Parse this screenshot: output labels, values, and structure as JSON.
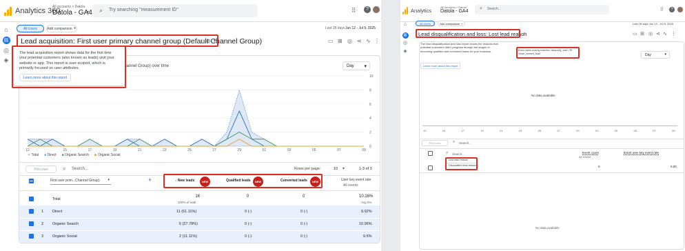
{
  "left": {
    "app_name": "Analytics 360",
    "account_path": "All accounts > Datola",
    "property": "Datola - GA4",
    "search_placeholder": "Try searching \"measurement ID\"",
    "segment": "All Users",
    "add_comparison": "Add comparison",
    "date_prefix": "Last 28 days",
    "date_range": "Jun 12 - Jul 9, 2025",
    "report_title": "Lead acquisition: First user primary channel group (Default Channel Group)",
    "tooltip_text": "The lead acquisition report shows data for the first time your potential customers (also known as leads) visit your website or app. This report is user-scoped, which is primarily focused on user attributes.",
    "tooltip_link": "Learn more about this report",
    "chart_caption_tail": "Channel Group) over time",
    "granularity": "Day",
    "table": {
      "search_placeholder": "Search...",
      "plot_rows": "Plot rows",
      "rows_per_page_label": "Rows per page:",
      "rows_per_page": "10",
      "pagination": "1-3 of 3",
      "dimension": "First user prim...Channel Group)",
      "columns": [
        "New leads",
        "Qualified leads",
        "Converted leads",
        "User key event rate"
      ],
      "col_sub": "All events",
      "badge": "NEW",
      "total_label": "Total",
      "totals": [
        "16",
        "0",
        "0",
        "10.16%"
      ],
      "totals_sub": [
        "100% of total",
        "",
        "",
        "Avg 0%"
      ],
      "rows": [
        {
          "n": "1",
          "name": "Direct",
          "v": [
            "11 (61.11%)",
            "0 (-)",
            "0 (-)",
            "9.92%"
          ]
        },
        {
          "n": "2",
          "name": "Organic Search",
          "v": [
            "5 (27.78%)",
            "0 (-)",
            "0 (-)",
            "10.96%"
          ]
        },
        {
          "n": "3",
          "name": "Organic Social",
          "v": [
            "2 (11.11%)",
            "0 (-)",
            "0 (-)",
            "9.5%"
          ]
        }
      ]
    }
  },
  "chart_data": {
    "type": "area",
    "x": [
      "12 Jun",
      "13",
      "14",
      "15",
      "16",
      "17",
      "18",
      "19",
      "20",
      "21",
      "22",
      "23",
      "24",
      "25",
      "26",
      "27",
      "28",
      "29",
      "30",
      "01 Jul",
      "02",
      "03",
      "04",
      "05",
      "06",
      "07",
      "08",
      "09"
    ],
    "x_ticks": [
      "12 Jun",
      "15",
      "17",
      "19",
      "21",
      "23",
      "25",
      "27",
      "29",
      "01 Jul",
      "03",
      "05",
      "07",
      "09"
    ],
    "y_ticks": [
      "10",
      "8",
      "6",
      "4",
      "2",
      "0"
    ],
    "ylim": [
      0,
      10
    ],
    "legend": [
      "Total",
      "Direct",
      "Organic Search",
      "Organic Social"
    ],
    "series": [
      {
        "name": "Total",
        "color": "#7aa6d6",
        "values": [
          1,
          1,
          1,
          0,
          0,
          1,
          0,
          0,
          1,
          1,
          0,
          1,
          0,
          0,
          1,
          0,
          2,
          8,
          2,
          1,
          0,
          0,
          0,
          0,
          0,
          0,
          0,
          0
        ]
      },
      {
        "name": "Direct",
        "color": "#3b78c4",
        "values": [
          1,
          0,
          1,
          0,
          0,
          0,
          0,
          0,
          1,
          0,
          0,
          1,
          0,
          0,
          1,
          0,
          1,
          5,
          1,
          0,
          0,
          0,
          0,
          0,
          0,
          0,
          0,
          0
        ]
      },
      {
        "name": "Organic Search",
        "color": "#4d9a6a",
        "values": [
          0,
          1,
          0,
          0,
          0,
          1,
          0,
          0,
          0,
          1,
          0,
          0,
          0,
          0,
          0,
          0,
          1,
          2,
          1,
          1,
          0,
          0,
          0,
          0,
          0,
          0,
          0,
          0
        ]
      },
      {
        "name": "Organic Social",
        "color": "#e8a33a",
        "values": [
          0,
          0,
          0,
          0,
          0,
          0,
          0,
          0,
          0,
          0,
          0,
          0,
          0,
          0,
          0,
          0,
          0,
          1,
          0,
          0,
          0,
          0,
          0,
          0,
          0,
          0,
          0,
          0
        ]
      }
    ]
  },
  "right": {
    "app_name": "Analytics",
    "account_path": "All accounts > Datola",
    "property": "Datola - GA4",
    "search_placeholder": "Search...",
    "segment": "All Users",
    "add_comparison": "Add comparison",
    "date_range": "Last 28 days  Jun 12 - Jul 9, 2025",
    "report_title": "Lead disqualification and loss: Lost lead reason",
    "tooltip_text": "The lead disqualification and loss report shows the reasons that potential customers didn't progress through the stages of becoming qualified and converted leads for your business.",
    "tooltip_link": "Learn more about this report",
    "note_text": "Event name exactly matches 'disqualify_lead' OR 'close_convert_lead'",
    "granularity": "Day",
    "no_data": "No data available",
    "x_ticks": [
      "12 Jun",
      "15",
      "17",
      "19",
      "21",
      "23",
      "25",
      "27",
      "29",
      "01 Jul",
      "03",
      "05",
      "07",
      "09"
    ],
    "plot_rows": "Plot rows",
    "col_event_count": "Event count",
    "col_event_sub": "All events",
    "col_key_rate": "Event user key event rate",
    "dim_labels": [
      "Lost lead reason",
      "Disqualified lead reason"
    ],
    "total_events": "0",
    "total_rate": "0.00",
    "table_no_data": "No data available"
  }
}
